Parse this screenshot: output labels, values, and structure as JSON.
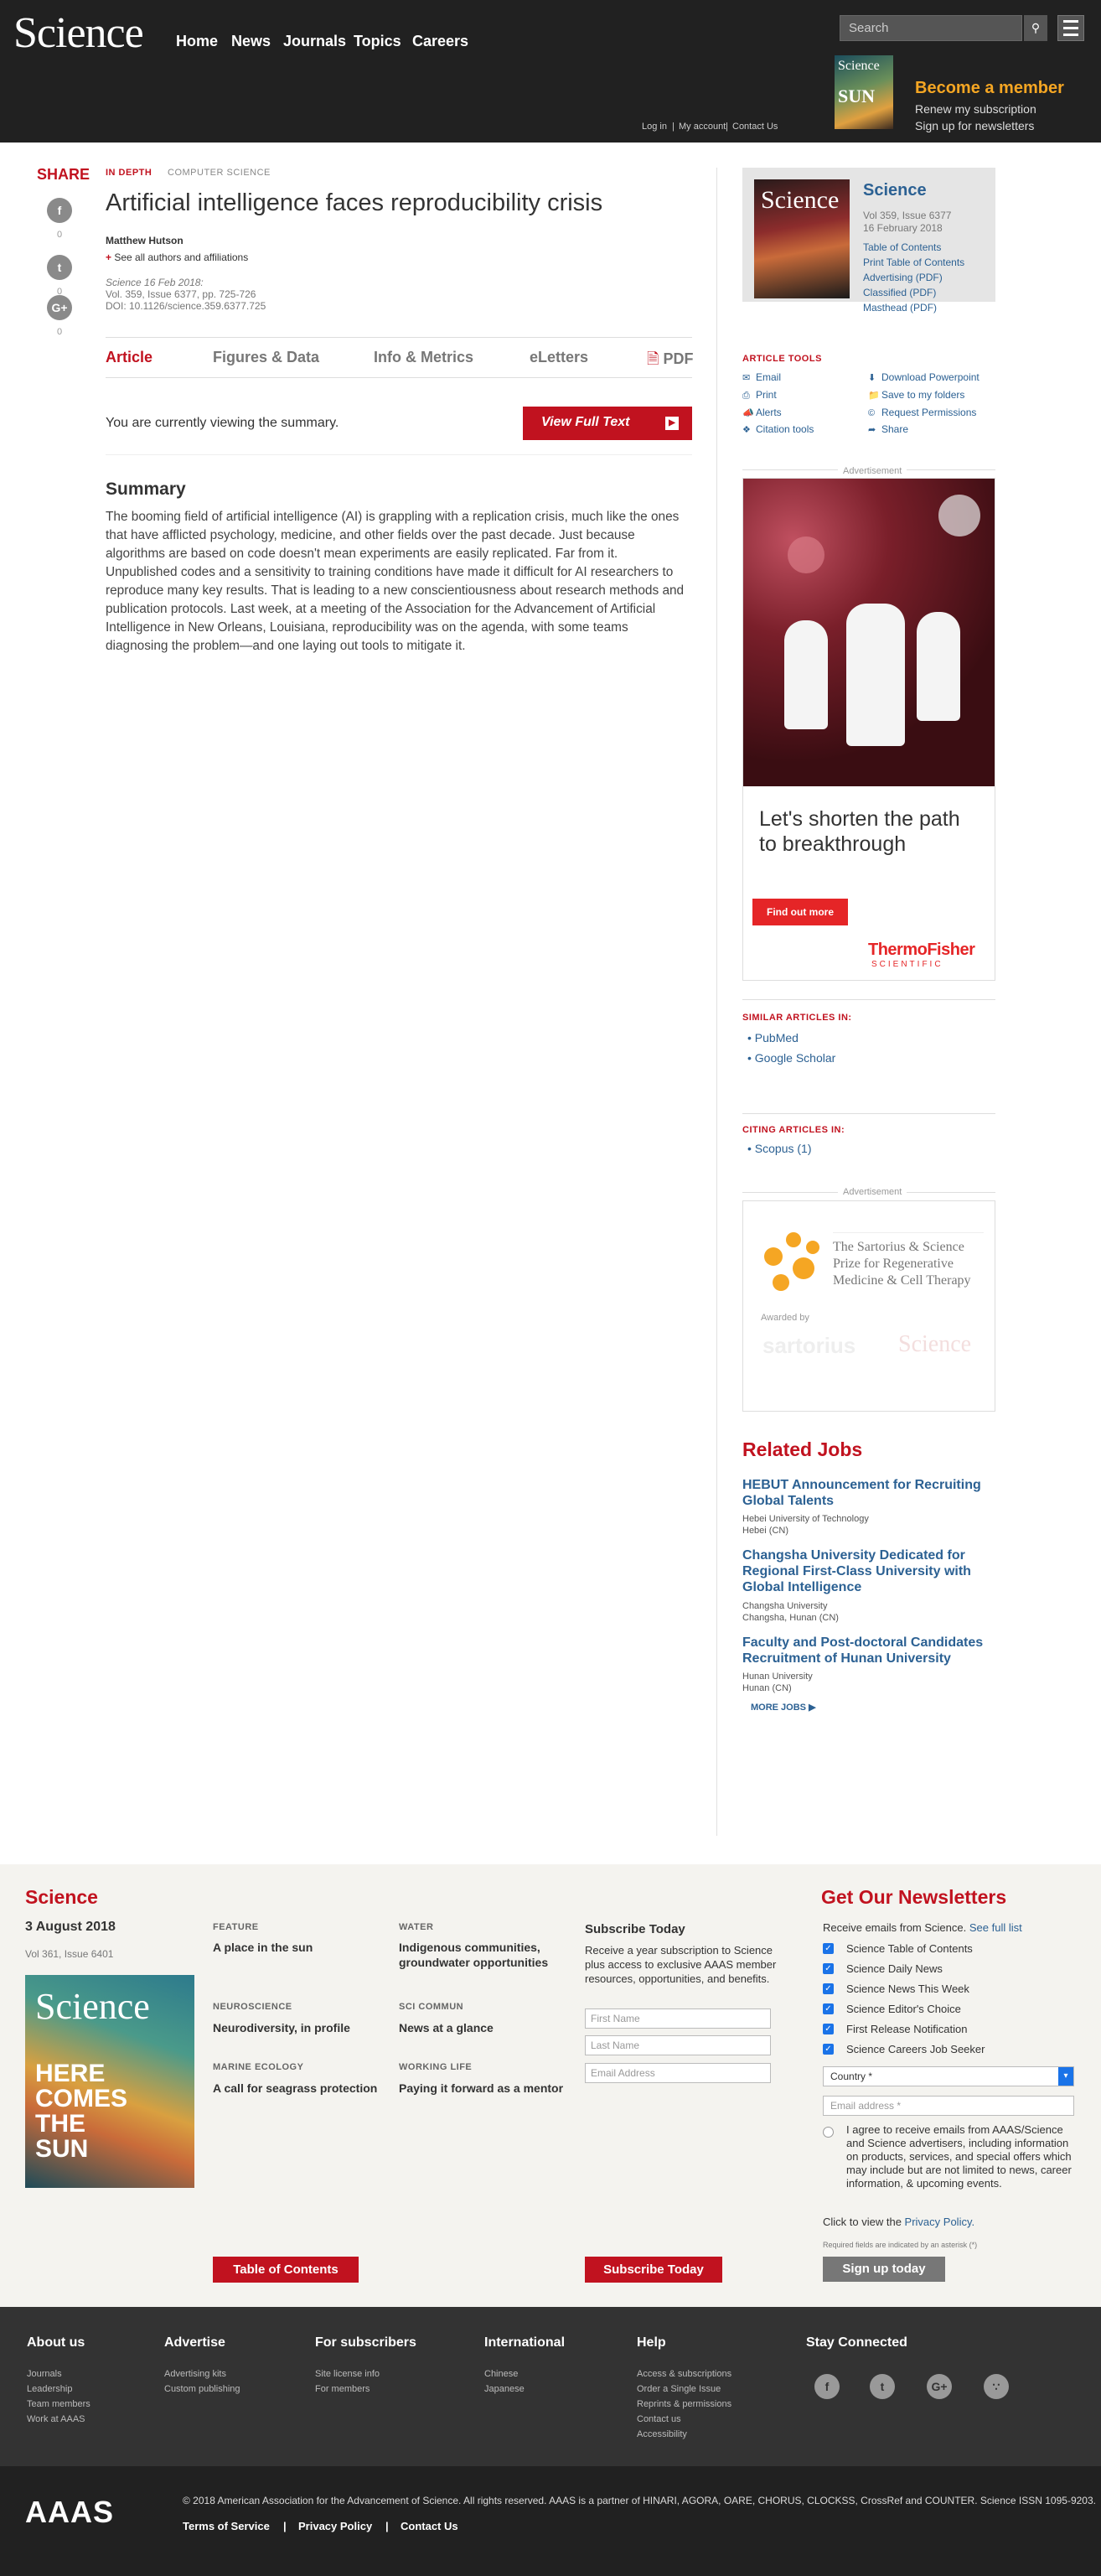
{
  "header": {
    "logo": "Science",
    "nav": [
      "Home",
      "News",
      "Journals",
      "Topics",
      "Careers"
    ],
    "search_placeholder": "Search",
    "promo": {
      "title": "Become a member",
      "lines": [
        "Renew my subscription",
        "Sign up for newsletters"
      ],
      "cover_text": "Science",
      "cover_sub": "SUN"
    },
    "util": [
      "Log in",
      "My account",
      "Contact Us"
    ]
  },
  "share": {
    "label": "SHARE",
    "counts": [
      "0",
      "0",
      "0"
    ]
  },
  "article": {
    "kicker": "IN DEPTH",
    "section": "COMPUTER SCIENCE",
    "title": "Artificial intelligence faces reproducibility crisis",
    "author": "Matthew Hutson",
    "affil": "See all authors and affiliations",
    "cite": [
      "Science  16 Feb 2018:",
      "Vol. 359, Issue 6377, pp. 725-726",
      "DOI: 10.1126/science.359.6377.725"
    ],
    "tabs": [
      "Article",
      "Figures & Data",
      "Info & Metrics",
      "eLetters",
      "PDF"
    ],
    "viewing": "You are currently viewing the summary.",
    "vft": "View Full Text",
    "summary_h": "Summary",
    "summary": "The booming field of artificial intelligence (AI) is grappling with a replication crisis, much like the ones that have afflicted psychology, medicine, and other fields over the past decade. Just because algorithms are based on code doesn't mean experiments are easily replicated. Far from it. Unpublished codes and a sensitivity to training conditions have made it difficult for AI researchers to reproduce many key results. That is leading to a new conscientiousness about research methods and publication protocols. Last week, at a meeting of the Association for the Advancement of Artificial Intelligence in New Orleans, Louisiana, reproducibility was on the agenda, with some teams diagnosing the problem—and one laying out tools to mitigate it."
  },
  "issue": {
    "title": "Science",
    "vol": "Vol 359, Issue 6377",
    "date": "16 February 2018",
    "links": [
      "Table of Contents",
      "Print Table of Contents",
      "Advertising (PDF)",
      "Classified (PDF)",
      "Masthead (PDF)"
    ],
    "cover_text": "Science"
  },
  "tools": {
    "heading": "ARTICLE TOOLS",
    "left": [
      "Email",
      "Print",
      "Alerts",
      "Citation tools"
    ],
    "right": [
      "Download Powerpoint",
      "Save to my folders",
      "Request Permissions",
      "Share"
    ]
  },
  "ad1": {
    "label": "Advertisement",
    "text": "Let's shorten the path to breakthrough",
    "btn": "Find out more",
    "brand1": "ThermoFisher",
    "brand2": "SCIENTIFIC"
  },
  "similar": {
    "heading": "SIMILAR ARTICLES IN:",
    "items": [
      "PubMed",
      "Google Scholar"
    ]
  },
  "citing": {
    "heading": "CITING ARTICLES IN:",
    "items": [
      "Scopus (1)"
    ]
  },
  "ad2": {
    "label": "Advertisement",
    "title": "The Sartorius & Science Prize for Regenerative Medicine & Cell Therapy",
    "awarded": "Awarded by",
    "sart": "sartorius",
    "sci": "Science"
  },
  "jobs": {
    "heading": "Related Jobs",
    "items": [
      {
        "title": "HEBUT Announcement for Recruiting Global Talents",
        "m1": "Hebei University of Technology",
        "m2": "Hebei (CN)"
      },
      {
        "title": "Changsha University Dedicated for Regional First-Class University with Global Intelligence",
        "m1": "Changsha University",
        "m2": "Changsha, Hunan (CN)"
      },
      {
        "title": "Faculty and Post-doctoral Candidates Recruitment of Hunan University",
        "m1": "Hunan University",
        "m2": "Hunan (CN)"
      }
    ],
    "more": "MORE JOBS ▶"
  },
  "footer": {
    "sci": "Science",
    "date": "3 August 2018",
    "vol": "Vol 361, Issue 6401",
    "cover_text": "Science",
    "cover_sub": "HERE COMES THE SUN",
    "features": [
      {
        "k": "FEATURE",
        "h": "A place in the sun"
      },
      {
        "k": "WATER",
        "h": "Indigenous communities, groundwater opportunities"
      },
      {
        "k": "NEUROSCIENCE",
        "h": "Neurodiversity, in profile"
      },
      {
        "k": "SCI COMMUN",
        "h": "News at a glance"
      },
      {
        "k": "MARINE ECOLOGY",
        "h": "A call for seagrass protection"
      },
      {
        "k": "WORKING LIFE",
        "h": "Paying it forward as a mentor"
      }
    ],
    "toc": "Table of Contents",
    "sub_h": "Subscribe Today",
    "sub_p": "Receive a year subscription to Science plus access to exclusive AAAS member resources, opportunities, and benefits.",
    "fields": [
      "First Name",
      "Last Name",
      "Email Address"
    ],
    "sub_btn": "Subscribe Today"
  },
  "newsletters": {
    "heading": "Get Our Newsletters",
    "intro": "Receive emails from Science.",
    "see": "See full list",
    "items": [
      "Science Table of Contents",
      "Science Daily News",
      "Science News This Week",
      "Science Editor's Choice",
      "First Release Notification",
      "Science Careers Job Seeker"
    ],
    "country": "Country *",
    "email": "Email address *",
    "agree": "I agree to receive emails from AAAS/Science and Science advertisers, including information on products, services, and special offers which may include but are not limited to news, career information, & upcoming events.",
    "privacy_pre": "Click to view the",
    "privacy": "Privacy Policy.",
    "req": "Required fields are indicated by an asterisk (*)",
    "btn": "Sign up today"
  },
  "bottom": {
    "cols": [
      {
        "h": "About us",
        "l": [
          "Journals",
          "Leadership",
          "Team members",
          "Work at AAAS"
        ]
      },
      {
        "h": "Advertise",
        "l": [
          "Advertising kits",
          "Custom publishing"
        ]
      },
      {
        "h": "For subscribers",
        "l": [
          "Site license info",
          "For members"
        ]
      },
      {
        "h": "International",
        "l": [
          "Chinese",
          "Japanese"
        ]
      },
      {
        "h": "Help",
        "l": [
          "Access & subscriptions",
          "Order a Single Issue",
          "Reprints & permissions",
          "Contact us",
          "Accessibility"
        ]
      },
      {
        "h": "Stay Connected",
        "l": []
      }
    ],
    "aaas": "AAAS",
    "copy": "© 2018 American Association for the Advancement of Science. All rights reserved. AAAS is a partner of HINARI, AGORA, OARE, CHORUS, CLOCKSS, CrossRef and COUNTER. Science ISSN 1095-9203.",
    "links": [
      "Terms of Service",
      "Privacy Policy",
      "Contact Us"
    ]
  }
}
